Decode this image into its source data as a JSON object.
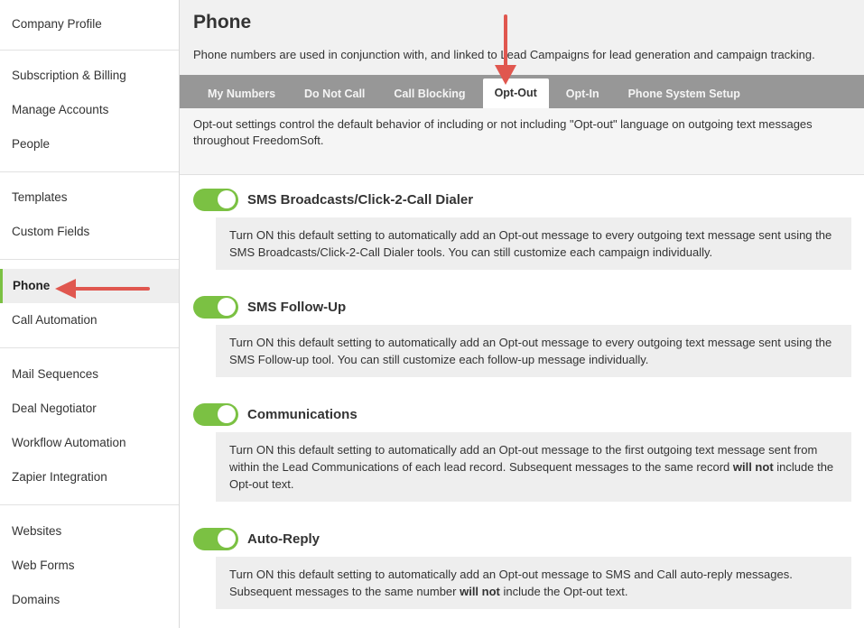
{
  "sidebar": {
    "groups": [
      {
        "items": [
          "Company Profile"
        ]
      },
      {
        "items": [
          "Subscription & Billing",
          "Manage Accounts",
          "People"
        ]
      },
      {
        "items": [
          "Templates",
          "Custom Fields"
        ]
      },
      {
        "items": [
          "Phone",
          "Call Automation"
        ]
      },
      {
        "items": [
          "Mail Sequences",
          "Deal Negotiator",
          "Workflow Automation",
          "Zapier Integration"
        ]
      },
      {
        "items": [
          "Websites",
          "Web Forms",
          "Domains"
        ]
      }
    ],
    "active_item": "Phone"
  },
  "header": {
    "title": "Phone",
    "description": "Phone numbers are used in conjunction with, and linked to Lead Campaigns for lead generation and campaign tracking."
  },
  "tabs": [
    "My Numbers",
    "Do Not Call",
    "Call Blocking",
    "Opt-Out",
    "Opt-In",
    "Phone System Setup"
  ],
  "active_tab": "Opt-Out",
  "intro": "Opt-out settings control the default behavior of including or not including \"Opt-out\" language on outgoing text messages throughout FreedomSoft.",
  "settings": [
    {
      "title": "SMS Broadcasts/Click-2-Call Dialer",
      "enabled": true,
      "text_parts": [
        "Turn ON this default setting to automatically add an Opt-out message to every outgoing text message sent using the SMS Broadcasts/Click-2-Call Dialer tools. You can still customize each campaign individually."
      ]
    },
    {
      "title": "SMS Follow-Up",
      "enabled": true,
      "text_parts": [
        "Turn ON this default setting to automatically add an Opt-out message to every outgoing text message sent using the SMS Follow-up tool. You can still customize each follow-up message individually."
      ]
    },
    {
      "title": "Communications",
      "enabled": true,
      "text_parts": [
        "Turn ON this default setting to automatically add an Opt-out message to the first outgoing text message sent from within the Lead Communications of each lead record. Subsequent messages to the same record ",
        "will not",
        " include the Opt-out text."
      ]
    },
    {
      "title": "Auto-Reply",
      "enabled": true,
      "text_parts": [
        "Turn ON this default setting to automatically add an Opt-out message to SMS and Call auto-reply messages. Subsequent messages to the same number ",
        "will not",
        " include the Opt-out text."
      ]
    }
  ],
  "colors": {
    "accent_green": "#7bc143",
    "tab_bar": "#979797",
    "annotation_arrow": "#e0574f"
  }
}
